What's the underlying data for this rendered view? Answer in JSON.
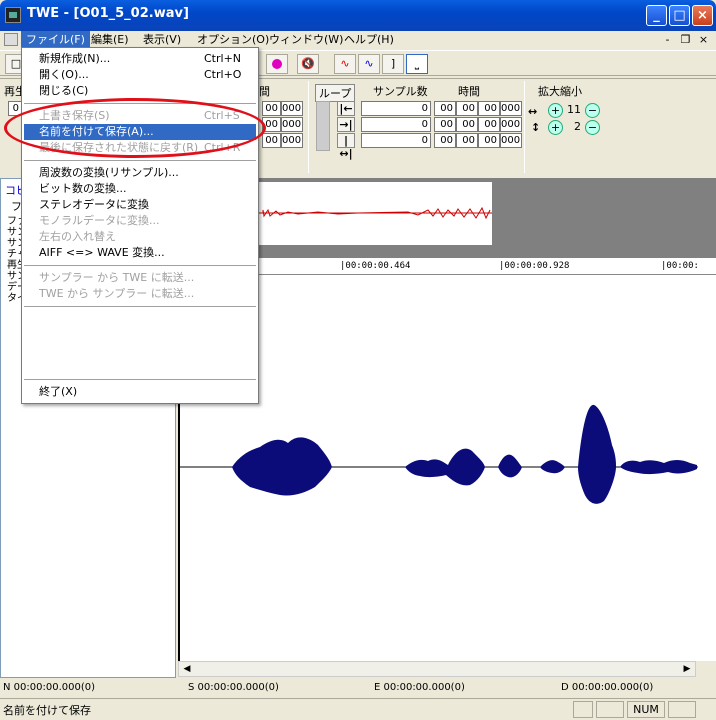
{
  "window": {
    "title": "TWE - [O01_5_02.wav]",
    "min": "_",
    "max": "□",
    "close": "×"
  },
  "menubar": {
    "items": [
      "ファイル(F)",
      "編集(E)",
      "表示(V)",
      "オプション(O)",
      "ウィンドウ(W)",
      "ヘルプ(H)"
    ],
    "mdi_min": "-",
    "mdi_restore": "❐",
    "mdi_close": "×"
  },
  "file_menu": {
    "group1": [
      {
        "label": "新規作成(N)...",
        "shortcut": "Ctrl+N"
      },
      {
        "label": "開く(O)...",
        "shortcut": "Ctrl+O"
      },
      {
        "label": "閉じる(C)",
        "shortcut": ""
      }
    ],
    "group2": [
      {
        "label": "上書き保存(S)",
        "shortcut": "Ctrl+S"
      },
      {
        "label": "名前を付けて保存(A)...",
        "shortcut": ""
      },
      {
        "label": "最後に保存された状態に戻す(R)",
        "shortcut": "Ctrl+R"
      }
    ],
    "group3": [
      {
        "label": "周波数の変換(リサンプル)..."
      },
      {
        "label": "ビット数の変換..."
      },
      {
        "label": "ステレオデータに変換"
      },
      {
        "label": "モノラルデータに変換..."
      },
      {
        "label": "左右の入れ替え"
      },
      {
        "label": "AIFF <=> WAVE 変換..."
      }
    ],
    "group4": [
      {
        "label": "サンプラー から TWE に転送..."
      },
      {
        "label": "TWE から サンプラー に転送..."
      }
    ],
    "exit": "終了(X)"
  },
  "panel": {
    "left_label": "再生",
    "left_value": "0",
    "time_label": "間",
    "loop_label": "ループ",
    "samples_label": "サンプル数",
    "time2_label": "時間",
    "zoom_label": "拡大縮小",
    "cell_00": "00",
    "cell_000": "000",
    "sample_value": "0",
    "zoom_h": "11",
    "zoom_v": "2"
  },
  "left_pane": {
    "heading": "コピ",
    "sub": "ファ",
    "lines": [
      "ファ",
      "サン",
      "サン",
      "チャ",
      "再生",
      "サン",
      "デー",
      "タイ"
    ]
  },
  "ruler": {
    "labels": [
      "|00:00:00.464",
      "|00:00:00.928",
      "|00:00:"
    ]
  },
  "status_fields": {
    "n": "N 00:00:00.000(0)",
    "s": "S 00:00:00.000(0)",
    "e": "E 00:00:00.000(0)",
    "d": "D 00:00:00.000(0)"
  },
  "statusbar": {
    "message": "名前を付けて保存",
    "num": "NUM"
  },
  "colors": {
    "highlight": "#316ac5",
    "annotation": "#e0101a",
    "waveform": "#0b0b7a"
  }
}
